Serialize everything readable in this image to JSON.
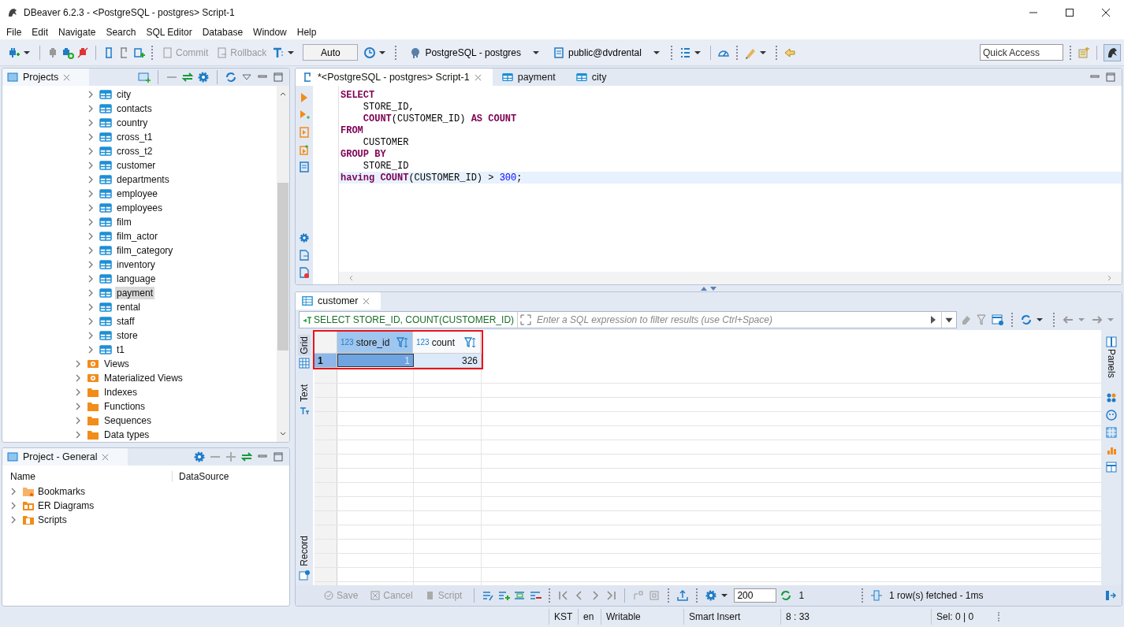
{
  "window": {
    "title": "DBeaver 6.2.3 - <PostgreSQL - postgres> Script-1"
  },
  "menu": [
    "File",
    "Edit",
    "Navigate",
    "Search",
    "SQL Editor",
    "Database",
    "Window",
    "Help"
  ],
  "toolbar": {
    "commit": {
      "label": "Commit",
      "disabled": true
    },
    "rollback": {
      "label": "Rollback",
      "disabled": true
    },
    "transaction_mode": "Auto",
    "datasource": "PostgreSQL - postgres",
    "schema": "public@dvdrental",
    "quick_access": {
      "placeholder": "Quick Access"
    }
  },
  "projects": {
    "title": "Projects",
    "tree": [
      {
        "children": [
          {
            "label": "city",
            "kind": "table",
            "selected": false
          },
          {
            "label": "contacts",
            "kind": "table",
            "selected": false
          },
          {
            "label": "country",
            "kind": "table",
            "selected": false
          },
          {
            "label": "cross_t1",
            "kind": "table",
            "selected": false
          },
          {
            "label": "cross_t2",
            "kind": "table",
            "selected": false
          },
          {
            "label": "customer",
            "kind": "table",
            "selected": false
          },
          {
            "label": "departments",
            "kind": "table",
            "selected": false
          },
          {
            "label": "employee",
            "kind": "table",
            "selected": false
          },
          {
            "label": "employees",
            "kind": "table",
            "selected": false
          },
          {
            "label": "film",
            "kind": "table",
            "selected": false
          },
          {
            "label": "film_actor",
            "kind": "table",
            "selected": false
          },
          {
            "label": "film_category",
            "kind": "table",
            "selected": false
          },
          {
            "label": "inventory",
            "kind": "table",
            "selected": false
          },
          {
            "label": "language",
            "kind": "table",
            "selected": false
          },
          {
            "label": "payment",
            "kind": "table",
            "selected": true
          },
          {
            "label": "rental",
            "kind": "table",
            "selected": false
          },
          {
            "label": "staff",
            "kind": "table",
            "selected": false
          },
          {
            "label": "store",
            "kind": "table",
            "selected": false
          },
          {
            "label": "t1",
            "kind": "table",
            "selected": false
          }
        ]
      },
      {
        "label": "Views",
        "kind": "view",
        "selected": false
      },
      {
        "label": "Materialized Views",
        "kind": "view",
        "selected": false
      },
      {
        "label": "Indexes",
        "kind": "folder",
        "selected": false
      },
      {
        "label": "Functions",
        "kind": "folder",
        "selected": false
      },
      {
        "label": "Sequences",
        "kind": "folder",
        "selected": false
      },
      {
        "label": "Data types",
        "kind": "folder",
        "selected": false
      }
    ]
  },
  "project_general": {
    "title": "Project - General",
    "columns": [
      "Name",
      "DataSource"
    ],
    "items": [
      {
        "label": "Bookmarks",
        "kind": "bookmarks"
      },
      {
        "label": "ER Diagrams",
        "kind": "diagrams"
      },
      {
        "label": "Scripts",
        "kind": "scripts"
      }
    ]
  },
  "editor": {
    "tabs": [
      {
        "label": "*<PostgreSQL - postgres> Script-1",
        "kind": "script",
        "selected": true,
        "closable": true
      },
      {
        "label": "payment",
        "kind": "table",
        "selected": false,
        "closable": false
      },
      {
        "label": "city",
        "kind": "table",
        "selected": false,
        "closable": false
      }
    ],
    "lines": [
      {
        "current": false,
        "tokens": [
          {
            "text": "SELECT",
            "kind": "keyword"
          }
        ]
      },
      {
        "current": false,
        "tokens": [
          {
            "text": "    STORE_ID,",
            "kind": "plain"
          }
        ]
      },
      {
        "current": false,
        "tokens": [
          {
            "text": "    COUNT",
            "kind": "keyword"
          },
          {
            "text": "(CUSTOMER_ID) ",
            "kind": "plain"
          },
          {
            "text": "AS COUNT",
            "kind": "keyword"
          }
        ]
      },
      {
        "current": false,
        "tokens": [
          {
            "text": "FROM",
            "kind": "keyword"
          }
        ]
      },
      {
        "current": false,
        "tokens": [
          {
            "text": "    CUSTOMER",
            "kind": "plain"
          }
        ]
      },
      {
        "current": false,
        "tokens": [
          {
            "text": "GROUP BY",
            "kind": "keyword"
          }
        ]
      },
      {
        "current": false,
        "tokens": [
          {
            "text": "    STORE_ID",
            "kind": "plain"
          }
        ]
      },
      {
        "current": true,
        "tokens": [
          {
            "text": "having COUNT",
            "kind": "keyword"
          },
          {
            "text": "(CUSTOMER_ID) > ",
            "kind": "plain"
          },
          {
            "text": "300",
            "kind": "number"
          },
          {
            "text": ";",
            "kind": "plain"
          }
        ]
      }
    ]
  },
  "results": {
    "tab": "customer",
    "query": "SELECT STORE_ID, COUNT(CUSTOMER_ID)",
    "filter": {
      "placeholder": "Enter a SQL expression to filter results (use Ctrl+Space)"
    },
    "side_tabs": [
      {
        "label": "Grid",
        "selected": true
      },
      {
        "label": "Text",
        "selected": false
      },
      {
        "label": "Record",
        "selected": false
      }
    ],
    "panels_label": "Panels",
    "highlighted": true,
    "columns": [
      {
        "type": "123",
        "name": "store_id",
        "selected": true
      },
      {
        "type": "123",
        "name": "count",
        "selected": false
      }
    ],
    "rows": [
      {
        "number": "1",
        "cells": [
          {
            "value": "1",
            "selected": true
          },
          {
            "value": "326",
            "selected": false
          }
        ]
      }
    ],
    "actions": [
      {
        "label": "Save",
        "kind": "save",
        "disabled": true
      },
      {
        "label": "Cancel",
        "kind": "cancel",
        "disabled": true
      },
      {
        "label": "Script",
        "kind": "script",
        "disabled": true
      }
    ],
    "fetch_size": "200",
    "refresh_count": "1",
    "status": "1 row(s) fetched - 1ms"
  },
  "status_bar": [
    "KST",
    "en",
    "Writable",
    "Smart Insert",
    "8 : 33",
    "Sel: 0 | 0"
  ]
}
